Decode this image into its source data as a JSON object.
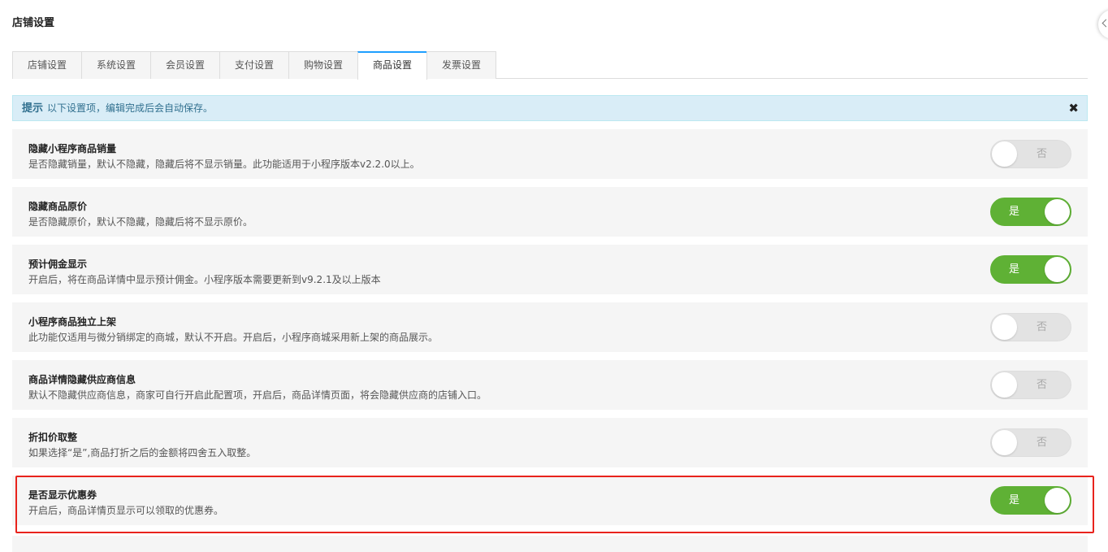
{
  "page": {
    "title": "店铺设置"
  },
  "tabs": [
    {
      "label": "店铺设置",
      "active": false
    },
    {
      "label": "系统设置",
      "active": false
    },
    {
      "label": "会员设置",
      "active": false
    },
    {
      "label": "支付设置",
      "active": false
    },
    {
      "label": "购物设置",
      "active": false
    },
    {
      "label": "商品设置",
      "active": true
    },
    {
      "label": "发票设置",
      "active": false
    }
  ],
  "tip": {
    "strong": "提示",
    "text": "以下设置项，编辑完成后会自动保存。",
    "close_icon": "close-icon"
  },
  "settings": [
    {
      "title": "隐藏小程序商品销量",
      "desc": "是否隐藏销量，默认不隐藏，隐藏后将不显示销量。此功能适用于小程序版本v2.2.0以上。",
      "on": false,
      "switch_text": "否"
    },
    {
      "title": "隐藏商品原价",
      "desc": "是否隐藏原价，默认不隐藏，隐藏后将不显示原价。",
      "on": true,
      "switch_text": "是"
    },
    {
      "title": "预计佣金显示",
      "desc": "开启后，将在商品详情中显示预计佣金。小程序版本需要更新到v9.2.1及以上版本",
      "on": true,
      "switch_text": "是"
    },
    {
      "title": "小程序商品独立上架",
      "desc": "此功能仅适用与微分销绑定的商城，默认不开启。开启后，小程序商城采用新上架的商品展示。",
      "on": false,
      "switch_text": "否"
    },
    {
      "title": "商品详情隐藏供应商信息",
      "desc": "默认不隐藏供应商信息，商家可自行开启此配置项，开启后，商品详情页面，将会隐藏供应商的店铺入口。",
      "on": false,
      "switch_text": "否"
    },
    {
      "title": "折扣价取整",
      "desc": "如果选择“是”,商品打折之后的金额将四舍五入取整。",
      "on": false,
      "switch_text": "否"
    },
    {
      "title": "是否显示优惠券",
      "desc": "开启后，商品详情页显示可以领取的优惠券。",
      "on": true,
      "switch_text": "是"
    }
  ],
  "colors": {
    "switch_on": "#5fb135",
    "switch_off": "#e3e3e3",
    "tip_bg": "#d9edf7",
    "highlight": "#e8231c",
    "tab_active_border": "#1e9fff"
  }
}
